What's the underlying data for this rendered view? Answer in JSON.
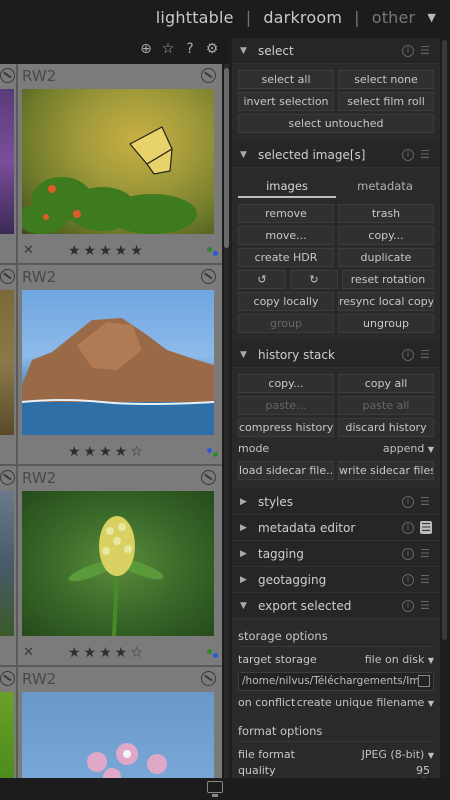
{
  "views": {
    "lighttable": "lighttable",
    "darkroom": "darkroom",
    "other": "other",
    "sep": "|"
  },
  "grid": {
    "thumbs": [
      {
        "ext": "RW2",
        "stars": "★★★★★",
        "dot": "#2b8a2b",
        "dot2": "#2a5bd7"
      },
      {
        "ext": "RW2",
        "stars": "★★★★☆",
        "dot": "#2a5bd7",
        "dot2": "#2b8a2b"
      },
      {
        "ext": "RW2",
        "stars": "★★★★☆",
        "dot": "#2b8a2b",
        "dot2": "#2a5bd7"
      },
      {
        "ext": "RW2"
      }
    ],
    "reject": "✕"
  },
  "select": {
    "title": "select",
    "select_all": "select all",
    "select_none": "select none",
    "invert": "invert selection",
    "film_roll": "select film roll",
    "untouched": "select untouched"
  },
  "selected": {
    "title": "selected image[s]",
    "tab_images": "images",
    "tab_metadata": "metadata",
    "remove": "remove",
    "trash": "trash",
    "move": "move...",
    "copy": "copy...",
    "create_hdr": "create HDR",
    "duplicate": "duplicate",
    "rotate_ccw": "↺",
    "rotate_cw": "↻",
    "reset_rotation": "reset rotation",
    "copy_locally": "copy locally",
    "resync": "resync local copy",
    "group": "group",
    "ungroup": "ungroup"
  },
  "history": {
    "title": "history stack",
    "copy": "copy...",
    "copy_all": "copy all",
    "paste": "paste...",
    "paste_all": "paste all",
    "compress": "compress history",
    "discard": "discard history",
    "mode_label": "mode",
    "mode_value": "append",
    "load_sidecar": "load sidecar file...",
    "write_sidecar": "write sidecar files"
  },
  "modules": {
    "styles": "styles",
    "metadata_editor": "metadata editor",
    "tagging": "tagging",
    "geotagging": "geotagging",
    "export": "export selected"
  },
  "export": {
    "storage_options": "storage options",
    "target_storage_label": "target storage",
    "target_storage_value": "file on disk",
    "path": "/home/nilvus/Téléchargements/Im",
    "on_conflict_label": "on conflict",
    "on_conflict_value": "create unique filename",
    "format_options": "format options",
    "file_format_label": "file format",
    "file_format_value": "JPEG (8-bit)",
    "quality_label": "quality",
    "quality_value": "95",
    "quality_fraction": 0.95
  }
}
